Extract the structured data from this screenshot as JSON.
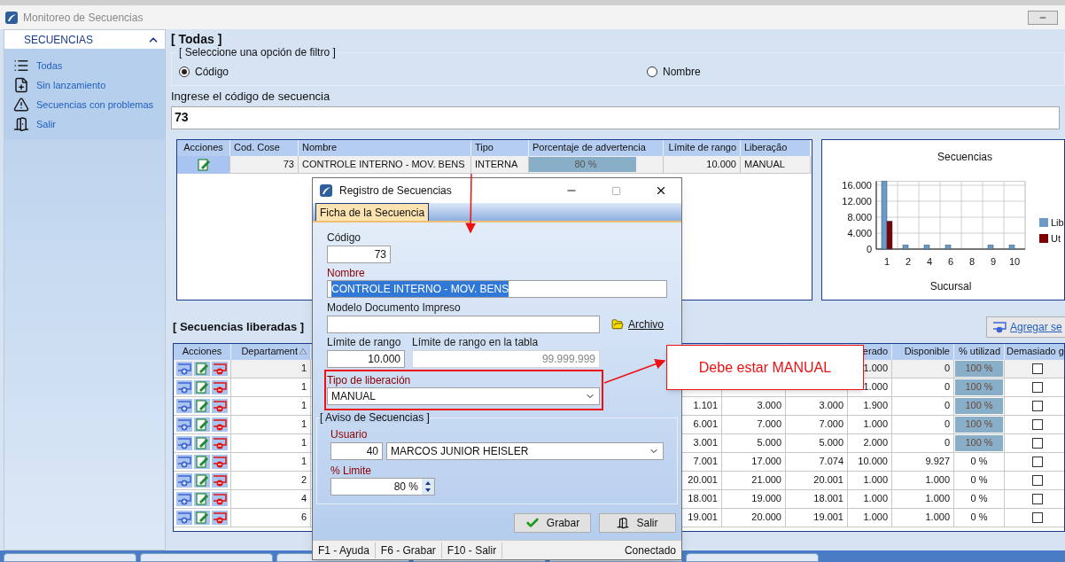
{
  "window": {
    "title": "Monitoreo de Secuencias"
  },
  "sidebar": {
    "header": "SECUENCIAS",
    "expanded": true,
    "items": [
      {
        "label": "Todas",
        "kind": "list"
      },
      {
        "label": "Sin lanzamiento",
        "kind": "document"
      },
      {
        "label": "Secuencias con problemas",
        "kind": "warning"
      },
      {
        "label": "Salir",
        "kind": "exit"
      }
    ]
  },
  "filter": {
    "title": "[ Todas ]",
    "group_label": "[ Seleccione una opción de filtro ]",
    "options": [
      {
        "label": "Código",
        "selected": true
      },
      {
        "label": "Nombre",
        "selected": false
      }
    ],
    "code_label": "Ingrese el código de secuencia",
    "code_value": "73"
  },
  "top_table": {
    "columns": [
      "Acciones",
      "Cod. Cose",
      "Nombre",
      "Tipo",
      "Porcentaje de advertencia",
      "Límite de rango",
      "Liberação"
    ],
    "rows": [
      {
        "cod": "73",
        "nombre": "CONTROLE INTERNO - MOV. BENS",
        "tipo": "INTERNA",
        "porcentaje": "80 %",
        "level": 0.8,
        "limite": "10.000",
        "liberacion": "MANUAL"
      }
    ]
  },
  "chart": {
    "chart_data": {
      "type": "bar",
      "title": "Secuencias",
      "xlabel": "Sucursal",
      "categories": [
        "1",
        "2",
        "4",
        "6",
        "8",
        "9",
        "10"
      ],
      "series": [
        {
          "name": "Lib",
          "color": "#6b9bc8",
          "values": [
            17000,
            1000,
            1000,
            1000,
            0,
            1000,
            1000
          ]
        },
        {
          "name": "Ut",
          "color": "#7f0000",
          "values": [
            7000,
            0,
            0,
            0,
            0,
            0,
            0
          ]
        }
      ],
      "ylim": [
        0,
        17000
      ],
      "yticks": [
        {
          "value": 0,
          "label": "0"
        },
        {
          "value": 4000,
          "label": "4.000"
        },
        {
          "value": 8000,
          "label": "8.000"
        },
        {
          "value": 12000,
          "label": "12.000"
        },
        {
          "value": 16000,
          "label": "16.000"
        }
      ],
      "grid": true,
      "legend": true
    }
  },
  "released": {
    "title": "[ Secuencias liberadas ]",
    "add_button": "Agregar se",
    "columns": [
      {
        "label": "Acciones"
      },
      {
        "label": "Departament",
        "sorted": true
      },
      {},
      {},
      {},
      {
        "label": "erado"
      },
      {
        "label": "Disponible"
      },
      {
        "label": "% utilizad"
      },
      {
        "label": "Demasiado g"
      }
    ],
    "rows": [
      {
        "departamento": "1",
        "column_6": "1.000",
        "disponible": "0",
        "utilizado": "100 %",
        "highlighted": true,
        "checked": false
      },
      {
        "departamento": "1",
        "column_6": "1.000",
        "disponible": "0",
        "utilizado": "100 %",
        "highlighted": true,
        "checked": false
      },
      {
        "departamento": "1",
        "column_3": "1.101",
        "column_4": "3.000",
        "column_5": "3.000",
        "column_6": "1.900",
        "disponible": "0",
        "utilizado": "100 %",
        "highlighted": true,
        "checked": false
      },
      {
        "departamento": "1",
        "column_3": "6.001",
        "column_4": "7.000",
        "column_5": "7.000",
        "column_6": "1.000",
        "disponible": "0",
        "utilizado": "100 %",
        "highlighted": true,
        "checked": false
      },
      {
        "departamento": "1",
        "column_3": "3.001",
        "column_4": "5.000",
        "column_5": "5.000",
        "column_6": "2.000",
        "disponible": "0",
        "utilizado": "100 %",
        "highlighted": true,
        "checked": false
      },
      {
        "departamento": "1",
        "column_3": "7.001",
        "column_4": "17.000",
        "column_5": "7.074",
        "column_6": "10.000",
        "disponible": "9.927",
        "utilizado": "0 %",
        "highlighted": false,
        "checked": false
      },
      {
        "departamento": "2",
        "column_3": "20.001",
        "column_4": "21.000",
        "column_5": "20.001",
        "column_6": "1.000",
        "disponible": "1.000",
        "utilizado": "0 %",
        "highlighted": false,
        "checked": false
      },
      {
        "departamento": "4",
        "column_3": "18.001",
        "column_4": "19.000",
        "column_5": "18.001",
        "column_6": "1.000",
        "disponible": "1.000",
        "utilizado": "0 %",
        "highlighted": false,
        "checked": false
      },
      {
        "departamento": "6",
        "column_3": "19.001",
        "column_4": "20.000",
        "column_5": "19.001",
        "column_6": "1.000",
        "disponible": "1.000",
        "utilizado": "0 %",
        "highlighted": false,
        "checked": false
      }
    ]
  },
  "dialog": {
    "title": "Registro de Secuencias",
    "tabs": [
      {
        "label": "Ficha de la Secuencia",
        "selected": true
      }
    ],
    "codigo_label": "Código",
    "codigo": "73",
    "nombre_label": "Nombre",
    "nombre": "CONTROLE INTERNO - MOV. BENS",
    "nombre_text_selected": true,
    "modelo_label": "Modelo Documento Impreso",
    "archivo_button": "Archivo",
    "limite_label": "Límite de rango",
    "limite": "10.000",
    "limite_tabla_label": "Límite de rango en la tabla",
    "limite_tabla": "99.999.999",
    "tipo_label": "Tipo de liberación",
    "tipo": "MANUAL",
    "aviso_label": "[ Aviso de Secuencias ]",
    "usuario_label": "Usuario",
    "usuario_id": "40",
    "usuario": "MARCOS JUNIOR HEISLER",
    "porc_label": "% Limite",
    "porc": "80 %",
    "buttons": [
      {
        "label": "Grabar",
        "kind": "save"
      },
      {
        "label": "Salir",
        "kind": "exit"
      }
    ],
    "status": [
      "F1 - Ayuda",
      "F6 - Grabar",
      "F10 - Salir"
    ],
    "connection": "Conectado"
  },
  "annotation": {
    "callout": "Debe estar MANUAL"
  }
}
